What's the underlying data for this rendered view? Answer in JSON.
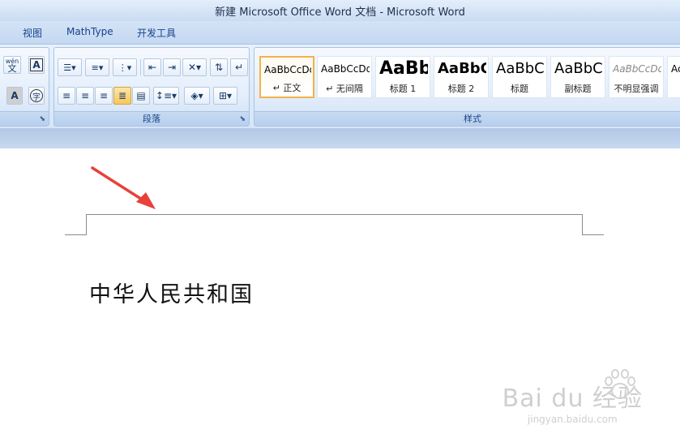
{
  "window": {
    "title": "新建 Microsoft Office Word 文档 - Microsoft Word"
  },
  "tabs": [
    {
      "label": "视图"
    },
    {
      "label": "MathType"
    },
    {
      "label": "开发工具"
    }
  ],
  "ribbon": {
    "font_group": {
      "phonetic_label": "wén",
      "phonetic_char": "文",
      "char_border_label": "A",
      "char_shading_label": "A",
      "enclose_label": "字"
    },
    "paragraph_group": {
      "label": "段落"
    },
    "styles_group": {
      "label": "样式"
    },
    "styles": [
      {
        "sample": "AaBbCcDd",
        "name": "↵ 正文",
        "selected": true
      },
      {
        "sample": "AaBbCcDd",
        "name": "↵ 无间隔"
      },
      {
        "sample": "AaBb",
        "name": "标题 1"
      },
      {
        "sample": "AaBbC",
        "name": "标题 2"
      },
      {
        "sample": "AaBbC",
        "name": "标题"
      },
      {
        "sample": "AaBbC",
        "name": "副标题"
      },
      {
        "sample": "AaBbCcDd",
        "name": "不明显强调"
      },
      {
        "sample": "Ac",
        "name": ""
      }
    ]
  },
  "document": {
    "text": "中华人民共和国"
  },
  "annotation": {
    "arrow_color": "#e8413a"
  },
  "watermark": {
    "brand": "Bai du 经验",
    "url": "jingyan.baidu.com"
  }
}
